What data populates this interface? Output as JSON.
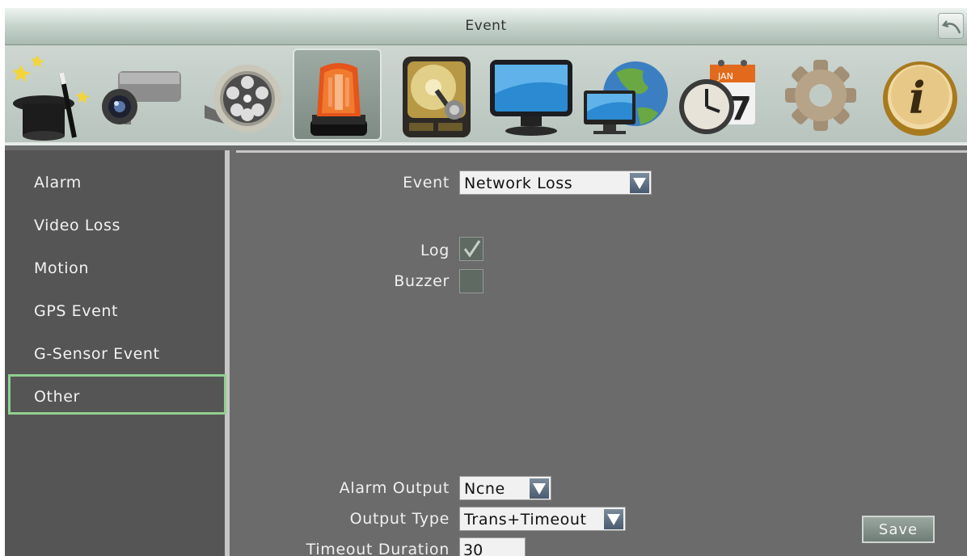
{
  "window": {
    "title": "Event"
  },
  "toolbar": {
    "icons": [
      "wizard-hat-icon",
      "camera-icon",
      "film-reel-icon",
      "alarm-siren-icon",
      "hard-disk-icon",
      "monitor-icon",
      "network-globe-icon",
      "clock-calendar-icon",
      "gear-icon",
      "info-icon"
    ],
    "active": "alarm-siren-icon",
    "calendar_month": "JAN",
    "calendar_day": "7",
    "info_letter": "i"
  },
  "sidebar": {
    "items": [
      {
        "label": "Alarm"
      },
      {
        "label": "Video Loss"
      },
      {
        "label": "Motion"
      },
      {
        "label": "GPS Event"
      },
      {
        "label": "G-Sensor Event"
      },
      {
        "label": "Other"
      }
    ],
    "selected": "Other"
  },
  "form": {
    "event_label": "Event",
    "event_value": "Network Loss",
    "log_label": "Log",
    "log_checked": true,
    "buzzer_label": "Buzzer",
    "buzzer_checked": false,
    "alarm_output_label": "Alarm Output",
    "alarm_output_value": "Ncne",
    "output_type_label": "Output Type",
    "output_type_value": "Trans+Timeout",
    "timeout_label": "Timeout Duration",
    "timeout_value": "30",
    "save_label": "Save"
  },
  "colors": {
    "panel": "#6b6b6b",
    "sidebar": "#555555",
    "selection": "#8fd08f",
    "titlebar": "#c9d6cf"
  }
}
